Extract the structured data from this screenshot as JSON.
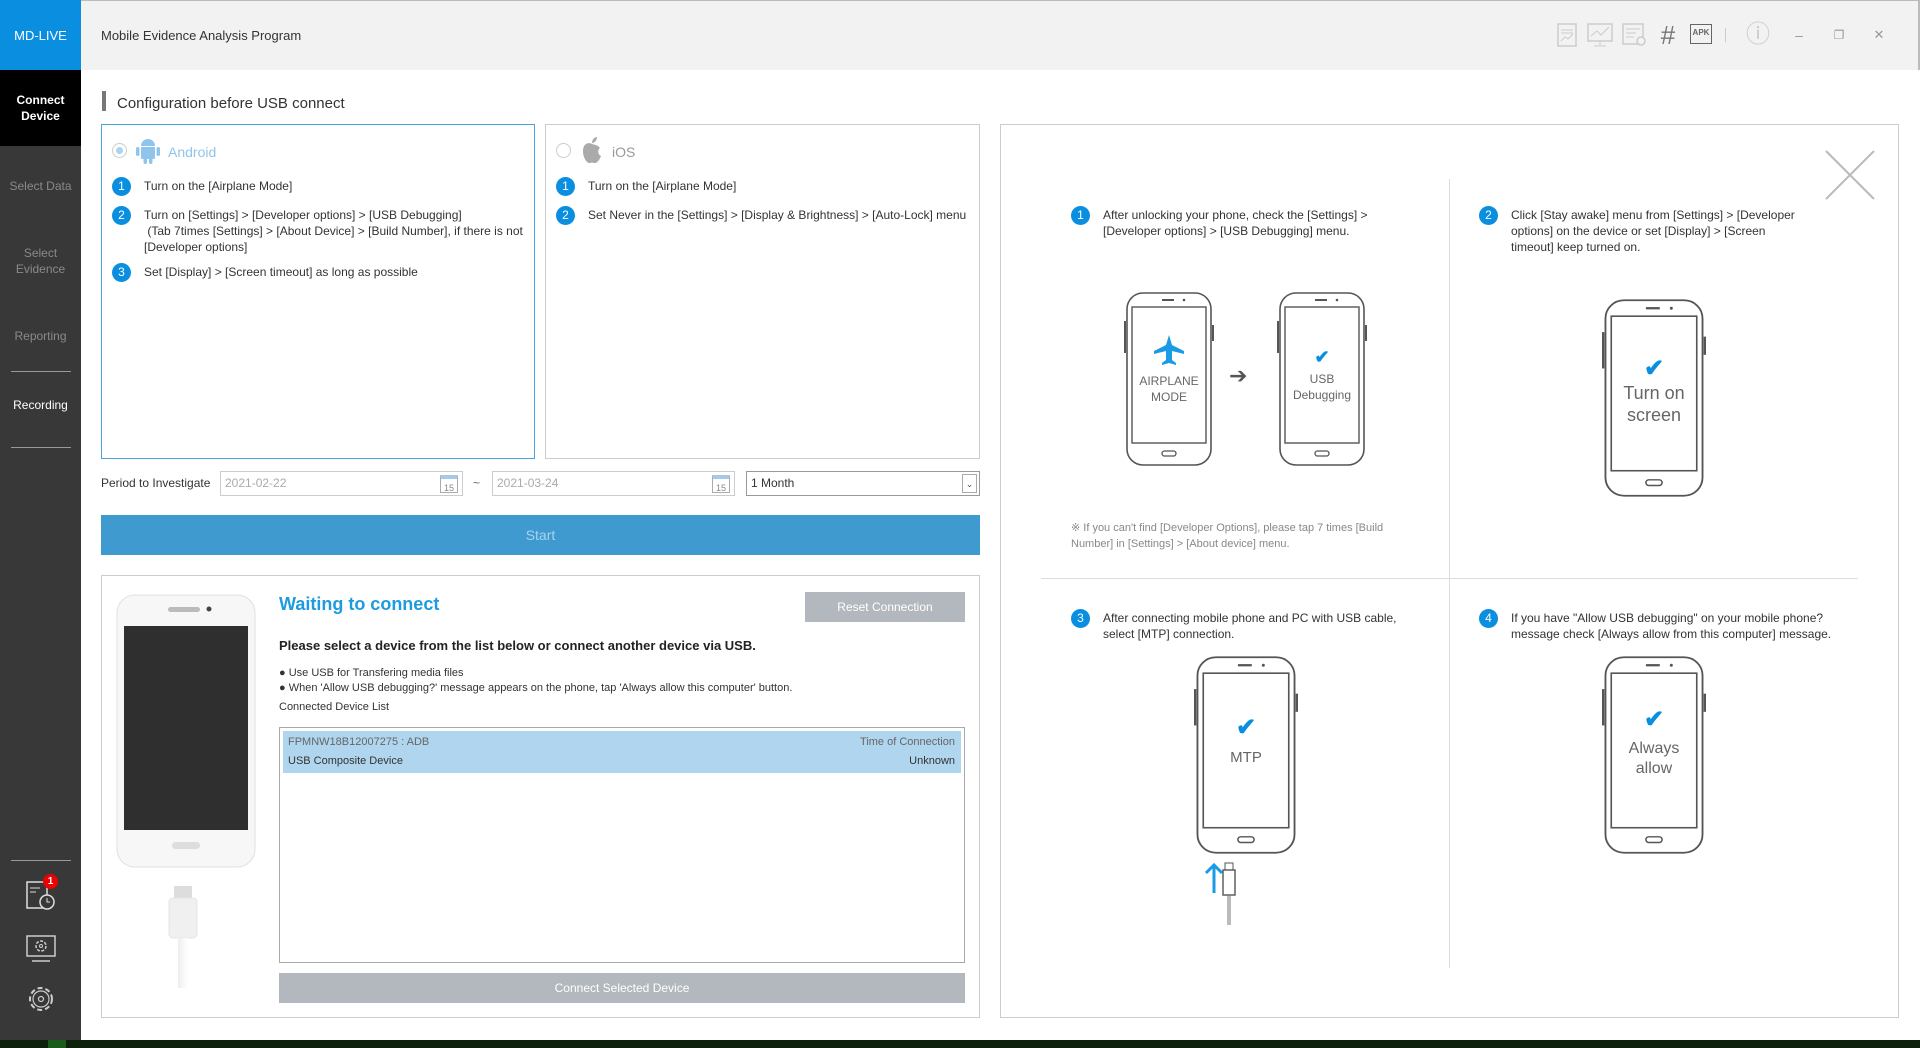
{
  "app": {
    "logo": "MD-LIVE",
    "title": "Mobile Evidence Analysis Program"
  },
  "toolbar": {
    "icons": [
      "report-icon",
      "monitor-chart-icon",
      "list-search-icon",
      "hash-icon",
      "apk-refresh-icon",
      "info-icon",
      "minimize-icon",
      "restore-icon",
      "close-icon"
    ],
    "hash": "#",
    "apk": "APK",
    "minimize": "–",
    "restore": "❐",
    "close": "✕",
    "info": "ⓘ"
  },
  "sidebar": {
    "items": [
      {
        "label": "Connect Device",
        "active": true
      },
      {
        "label": "Select Data"
      },
      {
        "label": "Select Evidence"
      },
      {
        "label": "Reporting"
      },
      {
        "label": "Recording"
      }
    ],
    "badge": "1"
  },
  "config": {
    "title": "Configuration before USB connect",
    "android": {
      "label": "Android",
      "selected": true,
      "steps": [
        {
          "n": "1",
          "text": "Turn on the [Airplane Mode]"
        },
        {
          "n": "2",
          "text": "Turn on [Settings] > [Developer options] > [USB Debugging]\n (Tab 7times [Settings] > [About Device] > [Build Number], if there is not [Developer options]"
        },
        {
          "n": "3",
          "text": "Set [Display] > [Screen timeout] as long as possible"
        }
      ]
    },
    "ios": {
      "label": "iOS",
      "selected": false,
      "steps": [
        {
          "n": "1",
          "text": "Turn on the [Airplane Mode]"
        },
        {
          "n": "2",
          "text": "Set Never in the [Settings] > [Display & Brightness] > [Auto-Lock] menu"
        }
      ]
    },
    "period_label": "Period to Investigate",
    "date_from": "2021-02-22",
    "date_to": "2021-03-24",
    "tilde": "~",
    "cal_day": "15",
    "period_select": "1 Month",
    "start": "Start"
  },
  "connect": {
    "title": "Waiting to connect",
    "reset": "Reset Connection",
    "instruction": "Please select a device from the list below or connect another device via USB.",
    "bullets": [
      "● Use USB for Transfering media files",
      "● When 'Allow USB debugging?' message appears on the phone, tap 'Always allow this computer' button."
    ],
    "list_label": "Connected Device List",
    "devices": [
      {
        "id": "FPMNW18B12007275 : ADB",
        "name": "USB Composite Device",
        "time_label": "Time of Connection",
        "time": "Unknown",
        "selected": true
      }
    ],
    "connect_button": "Connect Selected Device"
  },
  "guide": {
    "steps": [
      {
        "n": "1",
        "text": "After unlocking your phone, check the [Settings] > [Developer options] > [USB Debugging] menu."
      },
      {
        "n": "2",
        "text": "Click [Stay awake] menu from [Settings] > [Developer options] on the device or set [Display] > [Screen timeout] keep turned on."
      },
      {
        "n": "3",
        "text": "After connecting mobile phone and PC with USB cable, select [MTP] connection."
      },
      {
        "n": "4",
        "text": "If you have \"Allow USB debugging\" on your mobile phone? message check [Always allow from this computer] message."
      }
    ],
    "note": "※ If you can't find [Developer Options], please tap 7 times [Build Number] in [Settings] > [About device] menu.",
    "screens": {
      "airplane": "AIRPLANE\nMODE",
      "usb": "USB\nDebugging",
      "turn_on": "Turn on\nscreen",
      "mtp": "MTP",
      "always": "Always\nallow"
    },
    "accent": "#0a8fe0"
  }
}
